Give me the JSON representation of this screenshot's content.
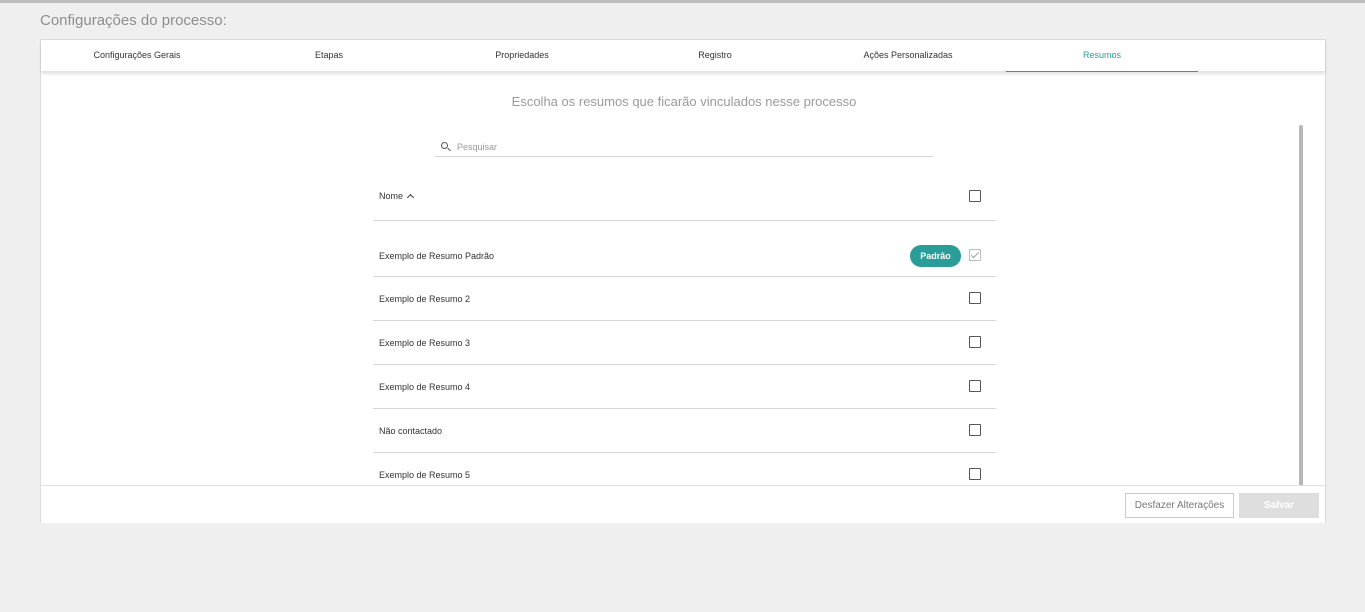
{
  "page": {
    "title": "Configurações do processo:"
  },
  "tabs": [
    {
      "label": "Configurações Gerais"
    },
    {
      "label": "Etapas"
    },
    {
      "label": "Propriedades"
    },
    {
      "label": "Registro"
    },
    {
      "label": "Ações Personalizadas"
    },
    {
      "label": "Resumos",
      "active": true
    }
  ],
  "main": {
    "heading": "Escolha os resumos que ficarão vinculados nesse processo",
    "search": {
      "placeholder": "Pesquisar",
      "value": ""
    },
    "table": {
      "column_name": "Nome",
      "rows": [
        {
          "name": "Exemplo de Resumo Padrão",
          "badge": "Padrão",
          "checked": true,
          "disabled": true
        },
        {
          "name": "Exemplo de Resumo 2",
          "checked": false
        },
        {
          "name": "Exemplo de Resumo 3",
          "checked": false
        },
        {
          "name": "Exemplo de Resumo 4",
          "checked": false
        },
        {
          "name": "Não contactado",
          "checked": false
        },
        {
          "name": "Exemplo de Resumo 5",
          "checked": false
        }
      ]
    }
  },
  "footer": {
    "undo_label": "Desfazer Alterações",
    "save_label": "Salvar"
  },
  "colors": {
    "accent": "#2a9d98",
    "background": "#efefef"
  }
}
